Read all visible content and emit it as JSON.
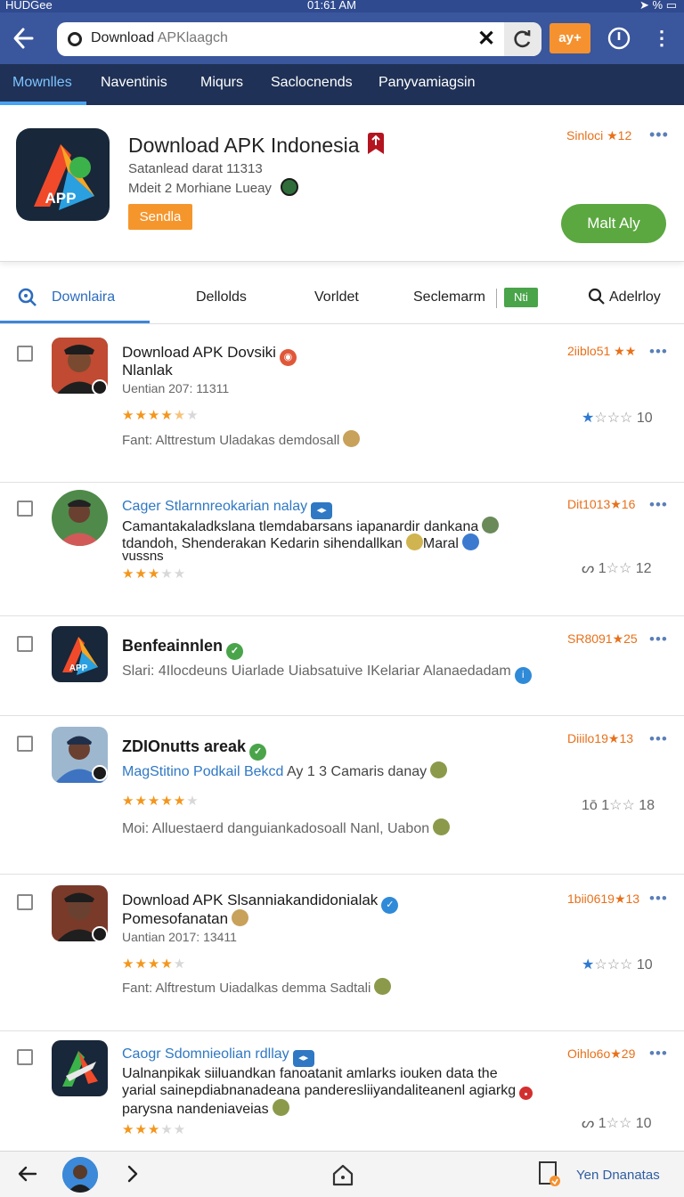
{
  "status": {
    "left": "HUDGee",
    "time": "01:61 AM",
    "battery": "%"
  },
  "browser": {
    "url_prefix": "Download",
    "url_muted": "APKlaagch",
    "ext_label": "ay+"
  },
  "nav_tabs": [
    "Mownlles",
    "Naventinis",
    "Miqurs",
    "Saclocnends",
    "Panyvamiagsin"
  ],
  "app": {
    "title": "Download APK Indonesia",
    "sub1": "Satanlead darat 11313",
    "sub2": "Mdeit 2 Morhiane Lueay",
    "send_label": "Sendla",
    "meta": "Sinloci ★12",
    "install_label": "Malt Aly",
    "icon_text": "APP"
  },
  "filters": {
    "downloads": "Downlaira",
    "deltoids": "Dellolds",
    "vorldet": "Vorldet",
    "seclemarm": "Seclemarm",
    "badge": "Nti",
    "adelrloy": "Adelrloy"
  },
  "items": [
    {
      "title1": "Download APK Dovsiki",
      "title2": "Nlanlak",
      "line1": "Uentian 207: 11311",
      "stars": "★★★★",
      "stars_half": "★",
      "stars_off": "★",
      "line2": "Fant: Alttrestum Uladakas demdosall",
      "meta": "2iiblo51 ★★",
      "rating_value": "10"
    },
    {
      "title1": "Cager Stlarnnreokarian nalay",
      "line1": "Camantakaladkslana tlemdabarsans iapanardir dankana",
      "line2": "tdandoh, Shenderakan Kedarin sihendallkan",
      "line2b": "Maral",
      "line3": "vussns",
      "stars": "★★★",
      "stars_off": "★★",
      "meta": "Dit1013★16",
      "rating_prefix": "ᔕ 1",
      "rating_value": "12"
    },
    {
      "title1": "Benfeainnlen",
      "line1": "Slari: 4Ilocdeuns Uiarlade Uiabsatuive IKelariar Alanaedadam",
      "meta": "SR8091★25",
      "icon_text": "APP"
    },
    {
      "title1": "ZDIOnutts areak",
      "line1": "MagStitino Podkail Bekcd",
      "line1b": "Ay 1 3 Camaris danay",
      "stars": "★★★★★",
      "stars_off": "★",
      "line2": "Moi: Alluestaerd danguiankadosoall Nanl, Uabon",
      "meta": "Diiilo19★13",
      "rating_prefix": "1ō 1",
      "rating_value": "18"
    },
    {
      "title1": "Download APK Slsanniakandidonialak",
      "title2": "Pomesofanatan",
      "line1": "Uantian 2017: 13411",
      "stars": "★★★★",
      "stars_off": "★",
      "line2": "Fant: Alftrestum Uiadalkas demma Sadtali",
      "meta": "1bii0619★13",
      "rating_value": "10"
    },
    {
      "title1": "Caogr Sdomnieolian rdllay",
      "line1": "Ualnanpikak siiluandkan  fanoatanit amlarks iouken data the",
      "line2": "yarial sainepdiabnanadeana panderesliiyandaliteanenl agiarkg",
      "line3": "parysna nandeniaveias",
      "stars": "★★★",
      "stars_off": "★★",
      "meta": "Oihlo6o★29",
      "rating_prefix": "ᔕ 1",
      "rating_value": "10"
    }
  ],
  "bottom": {
    "label": "Yen Dnanatas"
  },
  "colors": {
    "toolbar": "#3a569c",
    "navbar": "#1f3156",
    "accent_orange": "#f5922f",
    "install_green": "#5ba840",
    "meta_orange": "#e8701a",
    "link_blue": "#2f78c4"
  }
}
